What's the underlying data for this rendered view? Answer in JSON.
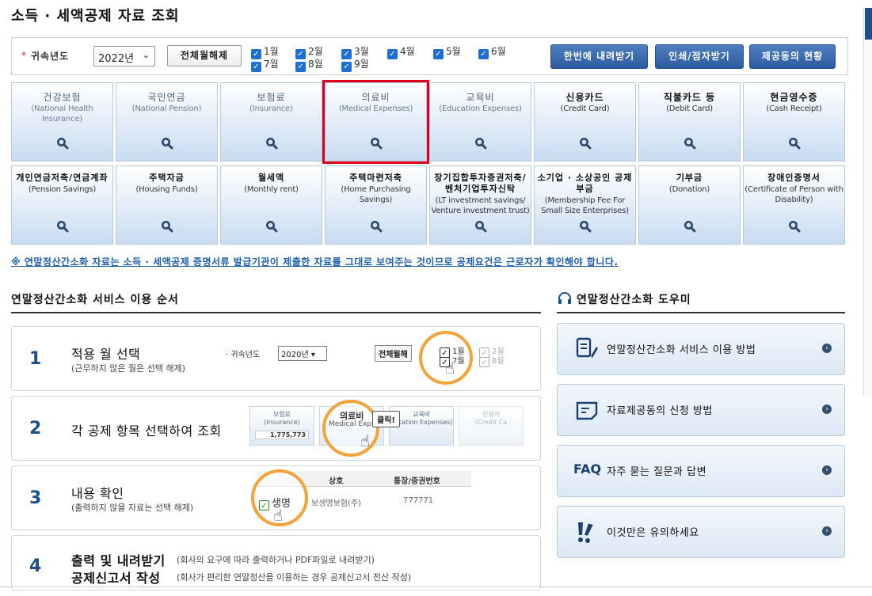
{
  "page_title": "소득 · 세액공제 자료 조회",
  "filter": {
    "year_label": "귀속년도",
    "year_value": "2022년",
    "clear_button": "전체월해제",
    "months": [
      "1월",
      "2월",
      "3월",
      "4월",
      "5월",
      "6월",
      "7월",
      "8월",
      "9월"
    ],
    "buttons": {
      "download_once": "한번에 내려받기",
      "print_braille": "인쇄/점자받기",
      "sharing_status": "제공동의 현황"
    }
  },
  "categories": [
    {
      "ko": "건강보험",
      "en": "(National Health Insurance)"
    },
    {
      "ko": "국민연금",
      "en": "(National Pension)"
    },
    {
      "ko": "보험료",
      "en": "(Insurance)"
    },
    {
      "ko": "의료비",
      "en": "(Medical Expenses)"
    },
    {
      "ko": "교육비",
      "en": "(Education Expenses)"
    },
    {
      "ko": "신용카드",
      "en": "(Credit Card)"
    },
    {
      "ko": "직불카드 등",
      "en": "(Debit Card)"
    },
    {
      "ko": "현금영수증",
      "en": "(Cash Receipt)"
    },
    {
      "ko": "개인연금저축/연금계좌",
      "en": "(Pension Savings)"
    },
    {
      "ko": "주택자금",
      "en": "(Housing Funds)"
    },
    {
      "ko": "월세액",
      "en": "(Monthly rent)"
    },
    {
      "ko": "주택마련저축",
      "en": "(Home Purchasing Savings)"
    },
    {
      "ko": "장기집합투자증권저축/벤처기업투자신탁",
      "en": "(LT investment savings/ Venture investment trust)"
    },
    {
      "ko": "소기업 · 소상공인 공제부금",
      "en": "(Membership Fee For Small Size Enterprises)"
    },
    {
      "ko": "기부금",
      "en": "(Donation)"
    },
    {
      "ko": "장애인증명서",
      "en": "(Certificate of Person with Disability)"
    }
  ],
  "notice": "※ 연말정산간소화 자료는 소득 · 세액공제 증명서류 발급기관이 제출한 자료를 그대로 보여주는 것이므로 공제요건은 근로자가 확인해야 합니다.",
  "steps_section": {
    "title": "연말정산간소화 서비스 이용 순서",
    "steps": [
      {
        "num": "1",
        "title": "적용 월 선택",
        "sub": "(근무하지 않은 월은 선택 해제)"
      },
      {
        "num": "2",
        "title": "각 공제 항목 선택하여 조회",
        "sub": ""
      },
      {
        "num": "3",
        "title": "내용 확인",
        "sub": "(출력하지 않을 자료는 선택 해제)"
      },
      {
        "num": "4",
        "title": "출력 및 내려받기",
        "sub": "(회사의 요구에 따라 출력하거나 PDF파일로 내려받기)",
        "title2": "공제신고서 작성",
        "sub2": "(회사가 편리한 연말정산을 이용하는 경우 공제신고서 전산 작성)"
      }
    ],
    "illus": {
      "s1_year_label": "· 귀속년도",
      "s1_year": "2020년",
      "s1_btn": "전체월해",
      "s1_m1": "1월",
      "s1_m2": "2월",
      "s1_m7": "7월",
      "s1_m8": "8월",
      "s2_t1_ko": "보험료",
      "s2_t1_en": "(Insurance)",
      "s2_t1_val": "1,775,773",
      "s2_t2_ko": "의료비",
      "s2_t2_en": "Medical Expen",
      "s2_t3_ko": "교육비",
      "s2_t3_en": "ducation Expenses)",
      "s2_t4_ko": "신용카",
      "s2_t4_en": "(Credit Ca",
      "s2_callout": "클릭!",
      "s3_col1": "상호",
      "s3_col2": "통장/증권번호",
      "s3_row1": "생명",
      "s3_row1b": "보생명보험(주)",
      "s3_row1v": "777771"
    }
  },
  "helper_section": {
    "title": "연말정산간소화 도우미",
    "items": [
      {
        "label": "연말정산간소화 서비스 이용 방법",
        "icon": "document-pen-icon"
      },
      {
        "label": "자료제공동의 신청 방법",
        "icon": "file-icon"
      },
      {
        "label": "자주 묻는 질문과 답변",
        "icon": "faq-icon",
        "icon_text": "FAQ"
      },
      {
        "label": "이것만은 유의하세요",
        "icon": "exclamation-icon"
      }
    ]
  }
}
